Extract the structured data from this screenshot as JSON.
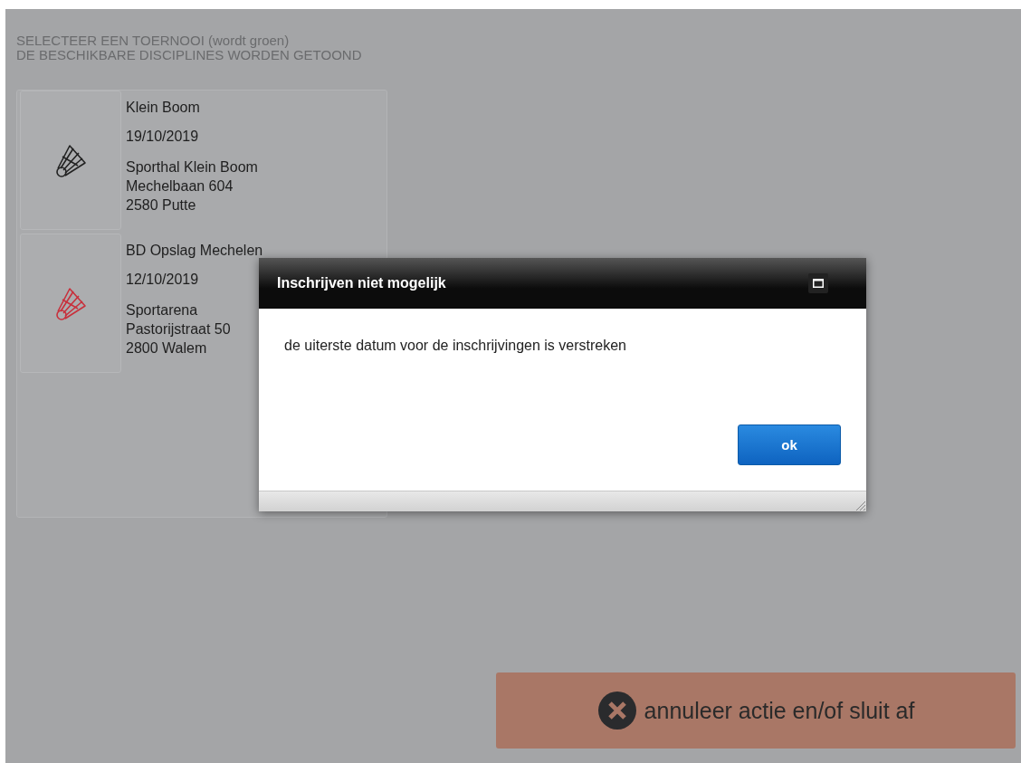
{
  "instructions": [
    "SELECTEER EEN TOERNOOI (wordt groen)",
    "DE BESCHIKBARE DISCIPLINES WORDEN GETOOND"
  ],
  "tournaments": [
    {
      "name": "Klein Boom",
      "date": "19/10/2019",
      "address": [
        "Sporthal Klein Boom",
        "Mechelbaan 604",
        "2580 Putte"
      ],
      "color": "#222222"
    },
    {
      "name": "BD Opslag Mechelen",
      "date": "12/10/2019",
      "address": [
        "Sportarena",
        "Pastorijstraat 50",
        "2800 Walem"
      ],
      "color": "#c8303c"
    }
  ],
  "dialog": {
    "title": "Inschrijven niet mogelijk",
    "message": "de uiterste datum voor de inschrijvingen is verstreken",
    "button": "ok"
  },
  "cancel_button": {
    "label": "annuleer actie en/of sluit af"
  }
}
